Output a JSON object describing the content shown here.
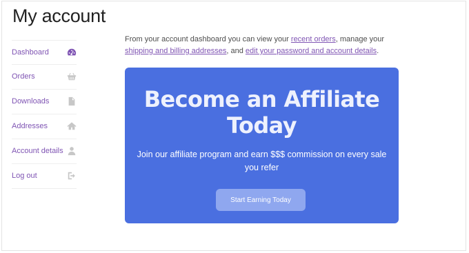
{
  "page": {
    "title": "My account"
  },
  "nav": {
    "items": [
      {
        "label": "Dashboard",
        "icon": "dashboard-gauge-icon",
        "active": true
      },
      {
        "label": "Orders",
        "icon": "basket-icon",
        "active": false
      },
      {
        "label": "Downloads",
        "icon": "file-icon",
        "active": false
      },
      {
        "label": "Addresses",
        "icon": "home-icon",
        "active": false
      },
      {
        "label": "Account details",
        "icon": "user-icon",
        "active": false
      },
      {
        "label": "Log out",
        "icon": "sign-out-icon",
        "active": false
      }
    ]
  },
  "intro": {
    "text_1": "From your account dashboard you can view your ",
    "link_orders": "recent orders",
    "text_2": ", manage your ",
    "link_addresses": "shipping and billing addresses",
    "text_3": ", and ",
    "link_password": "edit your password and account details",
    "text_4": "."
  },
  "banner": {
    "headline": "Become an Affiliate Today",
    "body": "Join our affiliate program and earn $$$ commission on every sale you refer",
    "button_label": "Start Earning Today"
  },
  "colors": {
    "accent": "#7f54b3",
    "banner_bg": "#4a6fe0",
    "button_bg": "#8fa7ef",
    "icon_inactive": "#c7c7c7"
  }
}
